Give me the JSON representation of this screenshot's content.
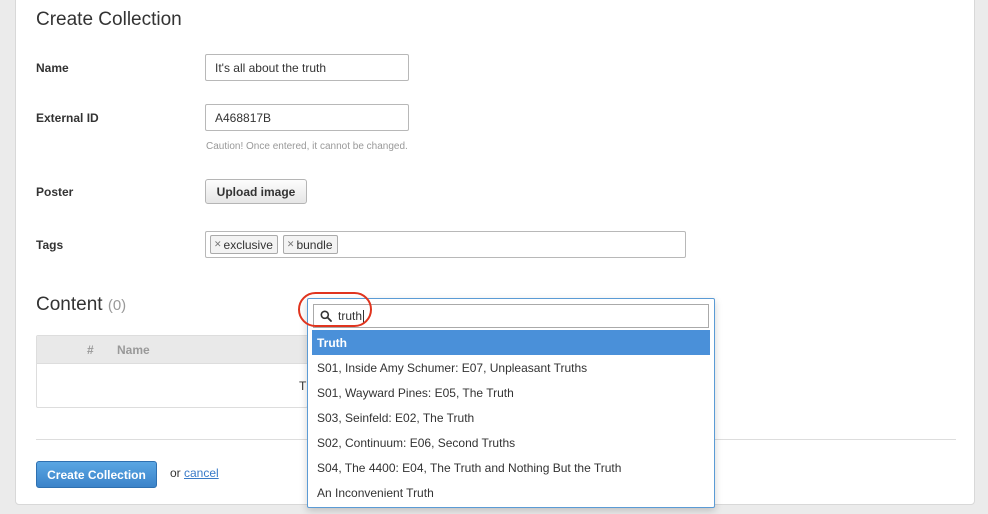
{
  "form": {
    "title": "Create Collection",
    "name": {
      "label": "Name",
      "value": "It's all about the truth"
    },
    "external_id": {
      "label": "External ID",
      "value": "A468817B",
      "hint": "Caution! Once entered, it cannot be changed."
    },
    "poster": {
      "label": "Poster",
      "button": "Upload image"
    },
    "tags": {
      "label": "Tags",
      "items": [
        "exclusive",
        "bundle"
      ]
    }
  },
  "content": {
    "title": "Content",
    "count": "(0)",
    "table": {
      "columns": [
        "#",
        "Name"
      ],
      "empty_text_fragment": "Th"
    }
  },
  "footer": {
    "submit_label": "Create Collection",
    "or_text": "or",
    "cancel_label": "cancel"
  },
  "search_dropdown": {
    "query": "truth",
    "results": [
      "Truth",
      "S01, Inside Amy Schumer: E07, Unpleasant Truths",
      "S01, Wayward Pines: E05, The Truth",
      "S03, Seinfeld: E02, The Truth",
      "S02, Continuum: E06, Second Truths",
      "S04, The 4400: E04, The Truth and Nothing But the Truth",
      "An Inconvenient Truth"
    ],
    "highlighted_index": 0
  },
  "colors": {
    "accent": "#4a90d9",
    "primary_button": "#3b83c9",
    "annotation_ring": "#e0341e"
  }
}
